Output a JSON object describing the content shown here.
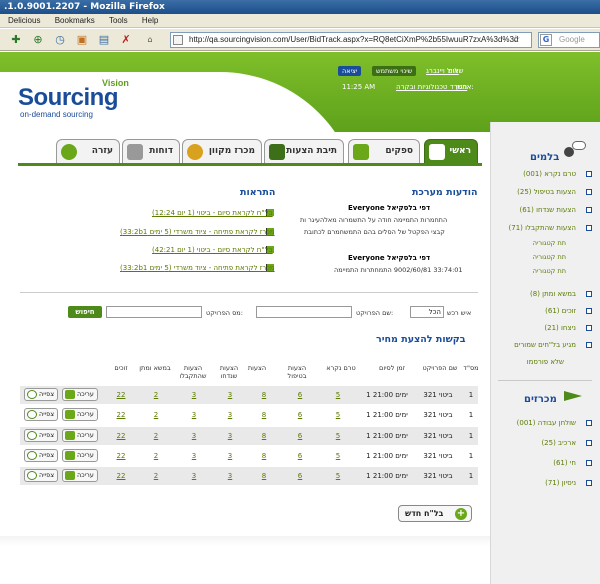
{
  "browser": {
    "title": ".1.0.9001.2207 - Mozilla Firefox",
    "menus": [
      "Delicious",
      "Bookmarks",
      "Tools",
      "Help"
    ],
    "url": "http://qa.sourcingvision.com/User/BidTrack.aspx?x=RQ8etCiXmP%2b55IwuuR7zxA%3d%3d",
    "search_placeholder": "Google"
  },
  "header": {
    "logo_vision": "Vision",
    "logo_main": "Sourcing",
    "logo_tag": "on-demand sourcing",
    "greeting_label": "שלום",
    "user_name": "אייל ויינברג",
    "change_user_btn": "שינוי משתמש",
    "logout_btn": "יציאה",
    "org_label": "ארגון:",
    "org_name": "משרד טכנולוגיות ובקרה",
    "time": "11:25 AM"
  },
  "tabs": [
    "ראשי",
    "ספקים",
    "תיבת הצעות",
    "מכרז מקוון",
    "דוחות",
    "עזרה"
  ],
  "system_messages": {
    "title": "הודעות מערכת",
    "msg1_title": "דפי בלסקיאל Everyone",
    "msg1_line1": "התחמרות התמיימה חודה על התשמרוה מאלהעיגר ות",
    "msg1_line2": "קבצי הפקטל של הסלים בהם התמשחמרם לכתובת",
    "msg2_title": "דפי בלסקיאל Everyone",
    "msg2_line1": "33:74:01 9002/60/81 התמחתרות התמיימה"
  },
  "alerts": {
    "title": "התראות",
    "items": [
      "בל\"ח לקראת סיום - ביטוי (1 יום 12:24)",
      "מכרז לקראת פתיחה - ציוד משרדי (5 ימים 33:2b1)",
      "בל\"ח לקראת סיום - ביטוי (1 יום 42:21)",
      "מכרז לקראת פתיחה - ציוד משרדי (5 ימים 33:2b1)"
    ]
  },
  "search": {
    "type_label": "איש רכש",
    "type_value": "הכל",
    "project_name_label": "שם הפרויקט:",
    "project_num_label": "מס הפרויקט:",
    "go_btn": "חיפוש"
  },
  "requests": {
    "title": "בקשות להצעת מחיר",
    "columns": [
      "מס\"ד",
      "שם הפרויקט",
      "זמן לסיום",
      "טרם נקרא",
      "הצעות בטיפול",
      "הצעות",
      "הצעות שנדחו",
      "הצעות שהתקבלו",
      "במשא ומתן",
      "זוכים"
    ],
    "rows": [
      {
        "num": "1",
        "name": "ביטוי 321",
        "time": "1 ימים 21:00",
        "unread": "5",
        "in_process": "6",
        "offers": "8",
        "rejected": "3",
        "accepted": "3",
        "negotiation": "2",
        "winners": "22"
      },
      {
        "num": "1",
        "name": "ביטוי 321",
        "time": "1 ימים 21:00",
        "unread": "5",
        "in_process": "6",
        "offers": "8",
        "rejected": "3",
        "accepted": "3",
        "negotiation": "2",
        "winners": "22"
      },
      {
        "num": "1",
        "name": "ביטוי 321",
        "time": "1 ימים 21:00",
        "unread": "5",
        "in_process": "6",
        "offers": "8",
        "rejected": "3",
        "accepted": "3",
        "negotiation": "2",
        "winners": "22"
      },
      {
        "num": "1",
        "name": "ביטוי 321",
        "time": "1 ימים 21:00",
        "unread": "5",
        "in_process": "6",
        "offers": "8",
        "rejected": "3",
        "accepted": "3",
        "negotiation": "2",
        "winners": "22"
      },
      {
        "num": "1",
        "name": "ביטוי 321",
        "time": "1 ימים 21:00",
        "unread": "5",
        "in_process": "6",
        "offers": "8",
        "rejected": "3",
        "accepted": "3",
        "negotiation": "2",
        "winners": "22"
      }
    ],
    "edit_btn": "עריכה",
    "view_btn": "צפייה",
    "new_btn": "בל\"ח חדש"
  },
  "sidebar": {
    "section1_title": "בלמים",
    "section1_items": [
      "טרם נקרא (001)",
      "הצעות בטיפול (25)",
      "הצעות שנדחו (61)",
      "הצעות שהתקבלו (71)"
    ],
    "section1_subitems": [
      "תת קטגוריה",
      "תת קטגוריה",
      "תת קטגוריה"
    ],
    "section1_items2": [
      "במשא ומתן (8)",
      "זוכים (61)",
      "ניצחו (21)",
      "מגיע בל\"חים שמורים"
    ],
    "section1_plain": "שלא פורסמו",
    "section2_title": "מכרזים",
    "section2_items": [
      "שולחן עבודה (001)",
      "ארכיב (25)",
      "חי (61)",
      "ניסיון (71)"
    ]
  },
  "colors": {
    "brand_green": "#5ea11b",
    "brand_blue": "#1a4d99",
    "link_green": "#5a7a00"
  }
}
